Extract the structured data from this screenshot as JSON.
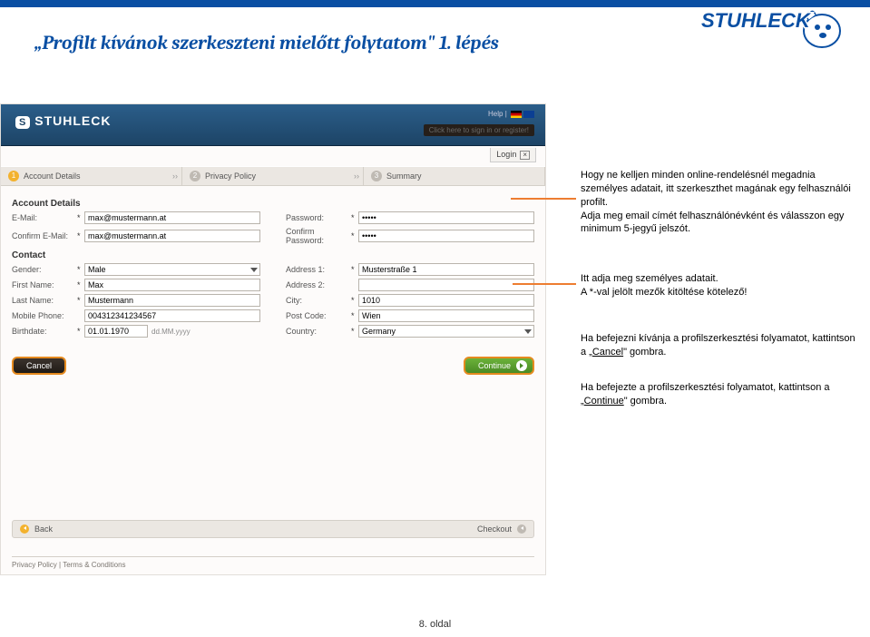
{
  "page_title": "„Profilt kívánok szerkeszteni mielőtt folytatom\" 1. lépés",
  "page_number": "8. oldal",
  "logo_text": "STUHLECK",
  "screenshot": {
    "brand": "STUHLECK",
    "help": "Help",
    "signin_prompt": "Click here to sign in or register!",
    "login_tab": "Login",
    "close_x": "×",
    "wizard": {
      "s1": "Account Details",
      "s2": "Privacy Policy",
      "s3": "Summary"
    },
    "section_account": "Account Details",
    "section_contact": "Contact",
    "labels": {
      "email": "E-Mail:",
      "confirm_email": "Confirm E-Mail:",
      "password": "Password:",
      "confirm_password": "Confirm Password:",
      "gender": "Gender:",
      "first_name": "First Name:",
      "last_name": "Last Name:",
      "mobile": "Mobile Phone:",
      "birthdate": "Birthdate:",
      "addr1": "Address 1:",
      "addr2": "Address 2:",
      "city": "City:",
      "postcode": "Post Code:",
      "country": "Country:"
    },
    "values": {
      "email": "max@mustermann.at",
      "confirm_email": "max@mustermann.at",
      "password": "•••••",
      "confirm_password": "•••••",
      "gender": "Male",
      "first_name": "Max",
      "last_name": "Mustermann",
      "mobile": "004312341234567",
      "birthdate": "01.01.1970",
      "birthdate_hint": "dd.MM.yyyy",
      "addr1": "Musterstraße 1",
      "addr2": "",
      "city": "1010",
      "postcode": "Wien",
      "country": "Germany"
    },
    "buttons": {
      "cancel": "Cancel",
      "continue": "Continue",
      "back": "Back",
      "checkout": "Checkout"
    },
    "footer": {
      "privacy": "Privacy Policy",
      "terms": "Terms & Conditions"
    }
  },
  "annotations": {
    "a1": "Hogy ne kelljen minden online-rendelésnél megadnia személyes adatait, itt szerkeszthet magának egy felhasználói profilt.\nAdja meg email címét felhasználónévként és válasszon egy minimum 5-jegyű jelszót.",
    "a2_l1": "Itt adja meg személyes adatait.",
    "a2_l2": "A *-val jelölt mezők kitöltése kötelező!",
    "a3_l1": "Ha befejezni kívánja a profilszerkesztési folyamatot, kattintson a „",
    "a3_cancel": "Cancel",
    "a3_l1b": "\" gombra.",
    "a4_l1": "Ha befejezte a profilszerkesztési folyamatot, kattintson a „",
    "a4_cont": "Continue",
    "a4_l1b": "\" gombra."
  }
}
